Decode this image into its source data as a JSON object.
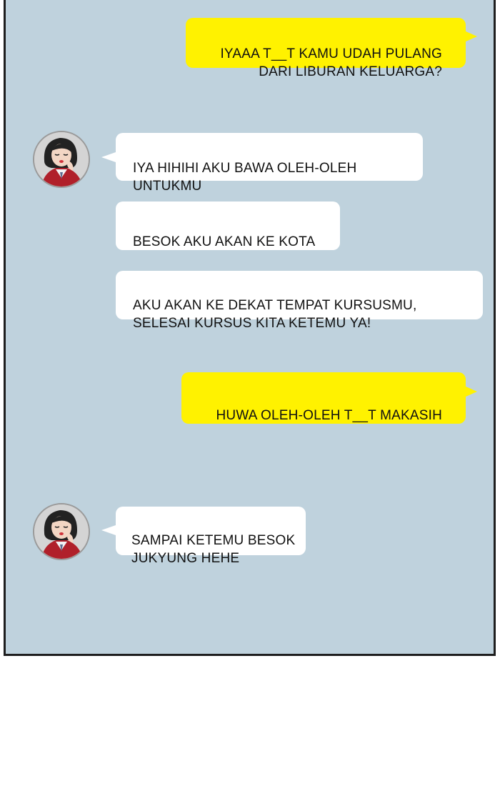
{
  "chat": {
    "messages": [
      {
        "sender": "self",
        "text": "IYAAA  T__T KAMU UDAH PULANG\nDARI LIBURAN KELUARGA?"
      },
      {
        "sender": "friend",
        "text": "IYA HIHIHI AKU BAWA OLEH-OLEH\nUNTUKMU"
      },
      {
        "sender": "friend",
        "text": "BESOK AKU AKAN KE KOTA"
      },
      {
        "sender": "friend",
        "text": "AKU AKAN KE DEKAT TEMPAT KURSUSMU,\nSELESAI KURSUS KITA KETEMU YA!"
      },
      {
        "sender": "self",
        "text": "HUWA OLEH-OLEH T__T MAKASIH"
      },
      {
        "sender": "friend",
        "text": "SAMPAI KETEMU BESOK\nJUKYUNG HEHE"
      }
    ]
  },
  "colors": {
    "background": "#bfd2dd",
    "self_bubble": "#fff200",
    "friend_bubble": "#ffffff",
    "border": "#1e1e1e"
  },
  "icons": {
    "avatar": "friend-avatar-icon"
  }
}
